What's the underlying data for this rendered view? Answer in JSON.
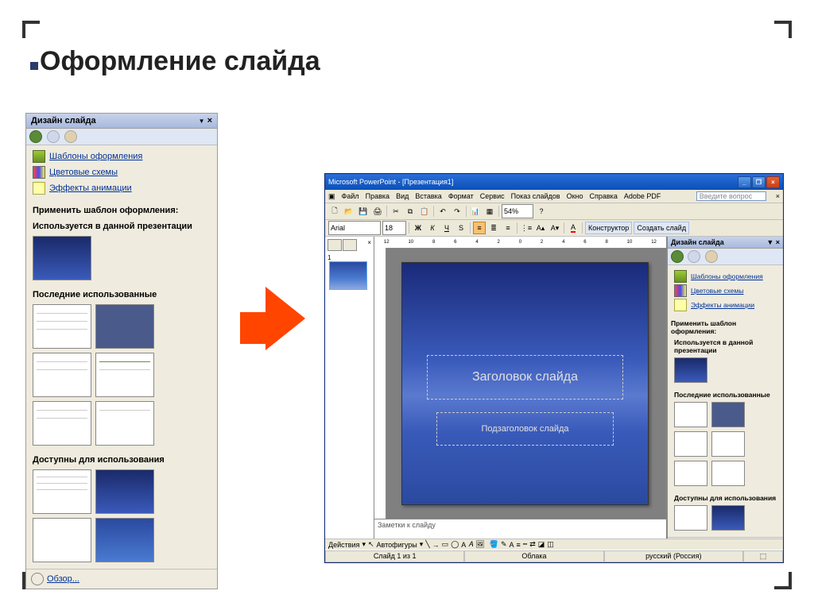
{
  "slide": {
    "title": "Оформление слайда"
  },
  "taskpane": {
    "title": "Дизайн слайда",
    "link_templates": "Шаблоны оформления",
    "link_colors": "Цветовые схемы",
    "link_anim": "Эффекты анимации",
    "apply_heading": "Применить шаблон оформления:",
    "section_used": "Используется в данной презентации",
    "section_recent": "Последние использованные",
    "section_available": "Доступны для использования",
    "browse": "Обзор..."
  },
  "pp": {
    "titlebar": "Microsoft PowerPoint - [Презентация1]",
    "menu": {
      "file": "Файл",
      "edit": "Правка",
      "view": "Вид",
      "insert": "Вставка",
      "format": "Формат",
      "service": "Сервис",
      "slideshow": "Показ слайдов",
      "window": "Окно",
      "help": "Справка",
      "adobe": "Adobe PDF"
    },
    "askbox": "Введите вопрос",
    "font": "Arial",
    "fontsize": "18",
    "zoom": "54%",
    "btn_constructor": "Конструктор",
    "btn_newslide": "Создать слайд",
    "slide_title": "Заголовок слайда",
    "slide_sub": "Подзаголовок слайда",
    "notes": "Заметки к слайду",
    "draw_actions": "Действия",
    "draw_autoshapes": "Автофигуры",
    "status_slide": "Слайд 1 из 1",
    "status_theme": "Облака",
    "status_lang": "русский (Россия)"
  }
}
